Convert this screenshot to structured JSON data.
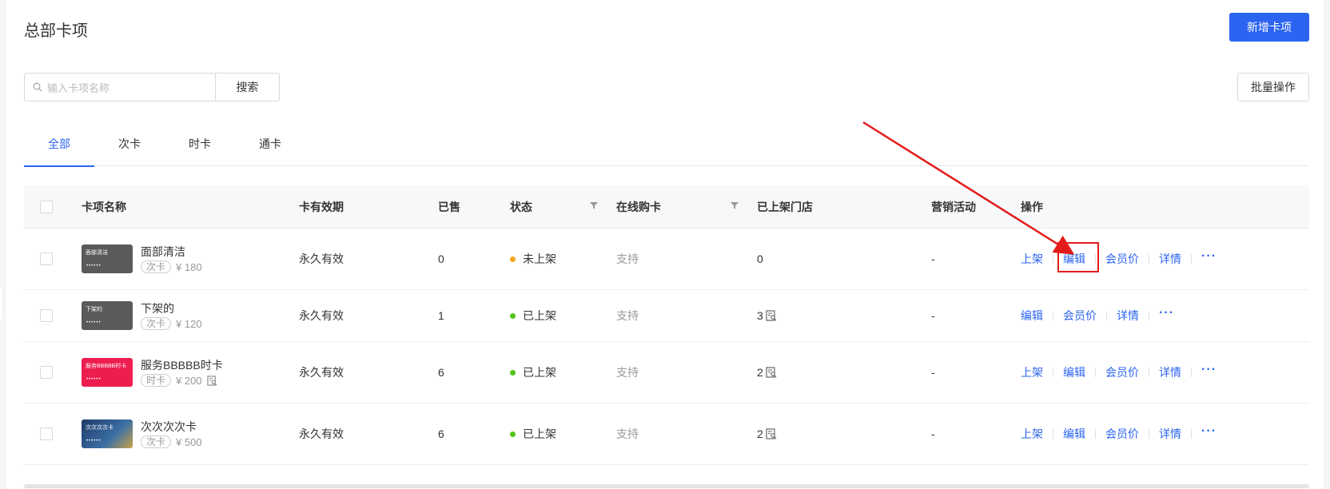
{
  "page": {
    "title": "总部卡项"
  },
  "header": {
    "add_button": "新增卡项",
    "batch_button": "批量操作"
  },
  "search": {
    "placeholder": "输入卡项名称",
    "button": "搜索"
  },
  "tabs": [
    {
      "label": "全部",
      "active": true
    },
    {
      "label": "次卡",
      "active": false
    },
    {
      "label": "时卡",
      "active": false
    },
    {
      "label": "通卡",
      "active": false
    }
  ],
  "table": {
    "columns": [
      "卡项名称",
      "卡有效期",
      "已售",
      "状态",
      "在线购卡",
      "已上架门店",
      "营销活动",
      "操作"
    ],
    "rows": [
      {
        "thumb_label": "面部清洁",
        "thumb_color": "#5a5a5a",
        "name": "面部清洁",
        "type": "次卡",
        "price": "¥ 180",
        "validity": "永久有效",
        "sold": "0",
        "status": "未上架",
        "status_color": "#f5a623",
        "online": "支持",
        "stores": "0",
        "marketing": "-",
        "ops": [
          "上架",
          "编辑",
          "会员价",
          "详情"
        ]
      },
      {
        "thumb_label": "下架的",
        "thumb_color": "#5a5a5a",
        "name": "下架的",
        "type": "次卡",
        "price": "¥ 120",
        "validity": "永久有效",
        "sold": "1",
        "status": "已上架",
        "status_color": "#52c41a",
        "online": "支持",
        "stores": "3",
        "marketing": "-",
        "ops": [
          "编辑",
          "会员价",
          "详情"
        ]
      },
      {
        "thumb_label": "服务BBBBB时卡",
        "thumb_color": "#ee1d4f",
        "name": "服务BBBBB时卡",
        "type": "时卡",
        "price": "¥ 200",
        "validity": "永久有效",
        "sold": "6",
        "status": "已上架",
        "status_color": "#52c41a",
        "online": "支持",
        "stores": "2",
        "marketing": "-",
        "ops": [
          "上架",
          "编辑",
          "会员价",
          "详情"
        ]
      },
      {
        "thumb_label": "次次次次卡",
        "thumb_color": "#1f3a66",
        "name": "次次次次卡",
        "type": "次卡",
        "price": "¥ 500",
        "validity": "永久有效",
        "sold": "6",
        "status": "已上架",
        "status_color": "#52c41a",
        "online": "支持",
        "stores": "2",
        "marketing": "-",
        "ops": [
          "上架",
          "编辑",
          "会员价",
          "详情"
        ]
      }
    ]
  },
  "colors": {
    "accent": "#2b64f0",
    "annotation": "#e41b1b"
  },
  "icons": [
    "search-icon",
    "filter-icon",
    "store-list-icon",
    "more-icon",
    "annotation-arrow"
  ]
}
